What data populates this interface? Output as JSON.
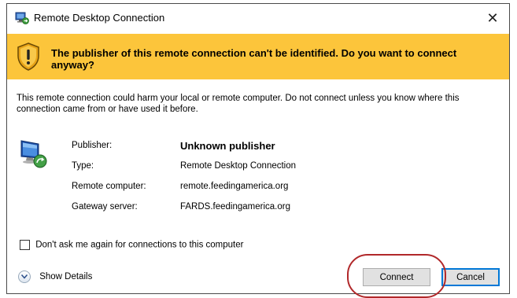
{
  "window": {
    "title": "Remote Desktop Connection",
    "close_glyph": "✕"
  },
  "banner": {
    "icon": "warning-shield-icon",
    "message": "The publisher of this remote connection can't be identified. Do you want to connect anyway?",
    "background_color": "#fcc53b"
  },
  "description": "This remote connection could harm your local or remote computer. Do not connect unless you know where this connection came from or have used it before.",
  "info": {
    "icon": "remote-computer-icon",
    "rows": [
      {
        "label": "Publisher:",
        "value": "Unknown publisher"
      },
      {
        "label": "Type:",
        "value": "Remote Desktop Connection"
      },
      {
        "label": "Remote computer:",
        "value": "remote.feedingamerica.org"
      },
      {
        "label": "Gateway server:",
        "value": "FARDS.feedingamerica.org"
      }
    ]
  },
  "checkbox": {
    "label": "Don't ask me again for connections to this computer",
    "checked": false
  },
  "details": {
    "label": "Show Details",
    "icon": "chevron-down-icon"
  },
  "buttons": {
    "connect_label": "Connect",
    "cancel_label": "Cancel"
  },
  "annotation": {
    "color": "#b1282a",
    "target": "connect-button"
  }
}
